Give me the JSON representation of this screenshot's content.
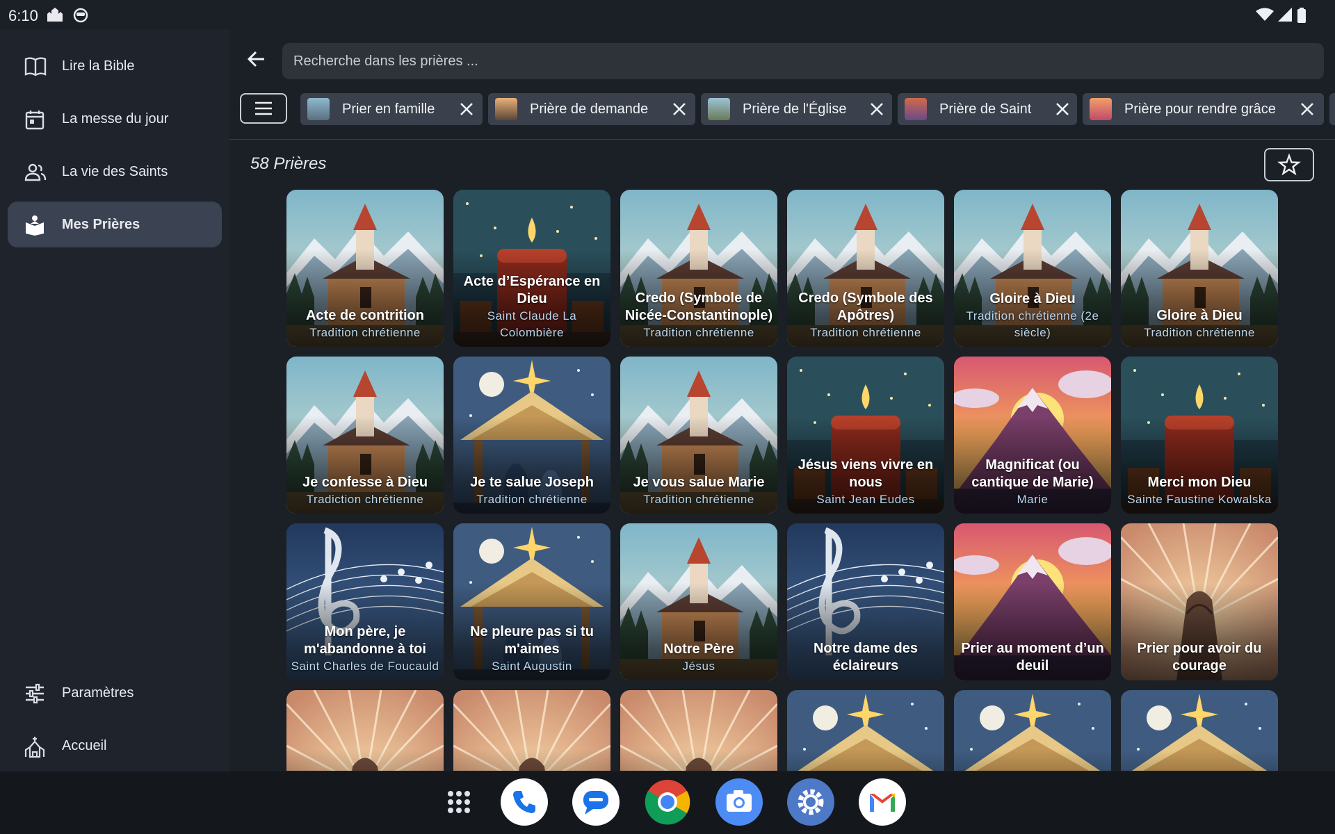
{
  "status_bar": {
    "time": "6:10"
  },
  "drawer": {
    "items": [
      {
        "label": "Lire la Bible",
        "icon": "book-icon"
      },
      {
        "label": "La messe du jour",
        "icon": "calendar-icon"
      },
      {
        "label": "La vie des Saints",
        "icon": "people-icon"
      },
      {
        "label": "Mes Prières",
        "icon": "prayer-icon",
        "active": true
      }
    ],
    "bottom_items": [
      {
        "label": "Paramètres",
        "icon": "sliders-icon"
      },
      {
        "label": "Accueil",
        "icon": "church-icon"
      }
    ]
  },
  "search": {
    "placeholder": "Recherche dans les prières ..."
  },
  "filters": [
    {
      "label": "Prier en famille"
    },
    {
      "label": "Prière de demande"
    },
    {
      "label": "Prière de l'Église"
    },
    {
      "label": "Prière de Saint"
    },
    {
      "label": "Prière pour rendre grâce"
    }
  ],
  "results": {
    "count_label": "58 Prières"
  },
  "prayers": [
    {
      "title": "Acte de contrition",
      "author": "Tradition chrétienne",
      "art": "church"
    },
    {
      "title": "Acte d’Espérance en Dieu",
      "author": "Saint Claude La Colombière",
      "art": "candle"
    },
    {
      "title": "Credo (Symbole de Nicée-Constantinople)",
      "author": "Tradition chrétienne",
      "art": "church"
    },
    {
      "title": "Credo (Symbole des Apôtres)",
      "author": "Tradition chrétienne",
      "art": "church"
    },
    {
      "title": "Gloire à Dieu",
      "author": "Tradition chrétienne (2e siècle)",
      "art": "church"
    },
    {
      "title": "Gloire à Dieu",
      "author": "Tradition chrétienne",
      "art": "church"
    },
    {
      "title": "Je confesse à Dieu",
      "author": "Tradiction chrétienne",
      "art": "church"
    },
    {
      "title": "Je te salue Joseph",
      "author": "Tradition chrétienne",
      "art": "nativity"
    },
    {
      "title": "Je vous salue Marie",
      "author": "Tradition chrétienne",
      "art": "church"
    },
    {
      "title": "Jésus viens vivre en nous",
      "author": "Saint Jean Eudes",
      "art": "candle"
    },
    {
      "title": "Magnificat (ou cantique de Marie)",
      "author": "Marie",
      "art": "sunset"
    },
    {
      "title": "Merci mon Dieu",
      "author": "Sainte Faustine Kowalska",
      "art": "candle"
    },
    {
      "title": "Mon père, je m'abandonne à toi",
      "author": "Saint Charles de Foucauld",
      "art": "music"
    },
    {
      "title": "Ne pleure pas si tu m'aimes",
      "author": "Saint Augustin",
      "art": "nativity"
    },
    {
      "title": "Notre Père",
      "author": "Jésus",
      "art": "church"
    },
    {
      "title": "Notre dame des éclaireurs",
      "author": "",
      "art": "music"
    },
    {
      "title": "Prier au moment d’un deuil",
      "author": "",
      "art": "sunset"
    },
    {
      "title": "Prier pour avoir du courage",
      "author": "",
      "art": "hands"
    },
    {
      "title": "",
      "author": "",
      "art": "hands"
    },
    {
      "title": "",
      "author": "",
      "art": "hands"
    },
    {
      "title": "",
      "author": "",
      "art": "hands"
    },
    {
      "title": "",
      "author": "",
      "art": "nativity"
    },
    {
      "title": "",
      "author": "",
      "art": "nativity"
    },
    {
      "title": "",
      "author": "",
      "art": "nativity"
    }
  ],
  "taskbar": {
    "apps": [
      {
        "icon": "app-drawer-icon"
      },
      {
        "icon": "phone-icon"
      },
      {
        "icon": "messages-icon"
      },
      {
        "icon": "chrome-icon"
      },
      {
        "icon": "camera-icon"
      },
      {
        "icon": "settings-icon"
      },
      {
        "icon": "gmail-icon"
      }
    ]
  },
  "colors": {
    "background": "#1b1f26",
    "drawer": "#1f232b",
    "active_nav": "#3b4252",
    "chip": "#3a404c",
    "search": "#2e3239"
  }
}
